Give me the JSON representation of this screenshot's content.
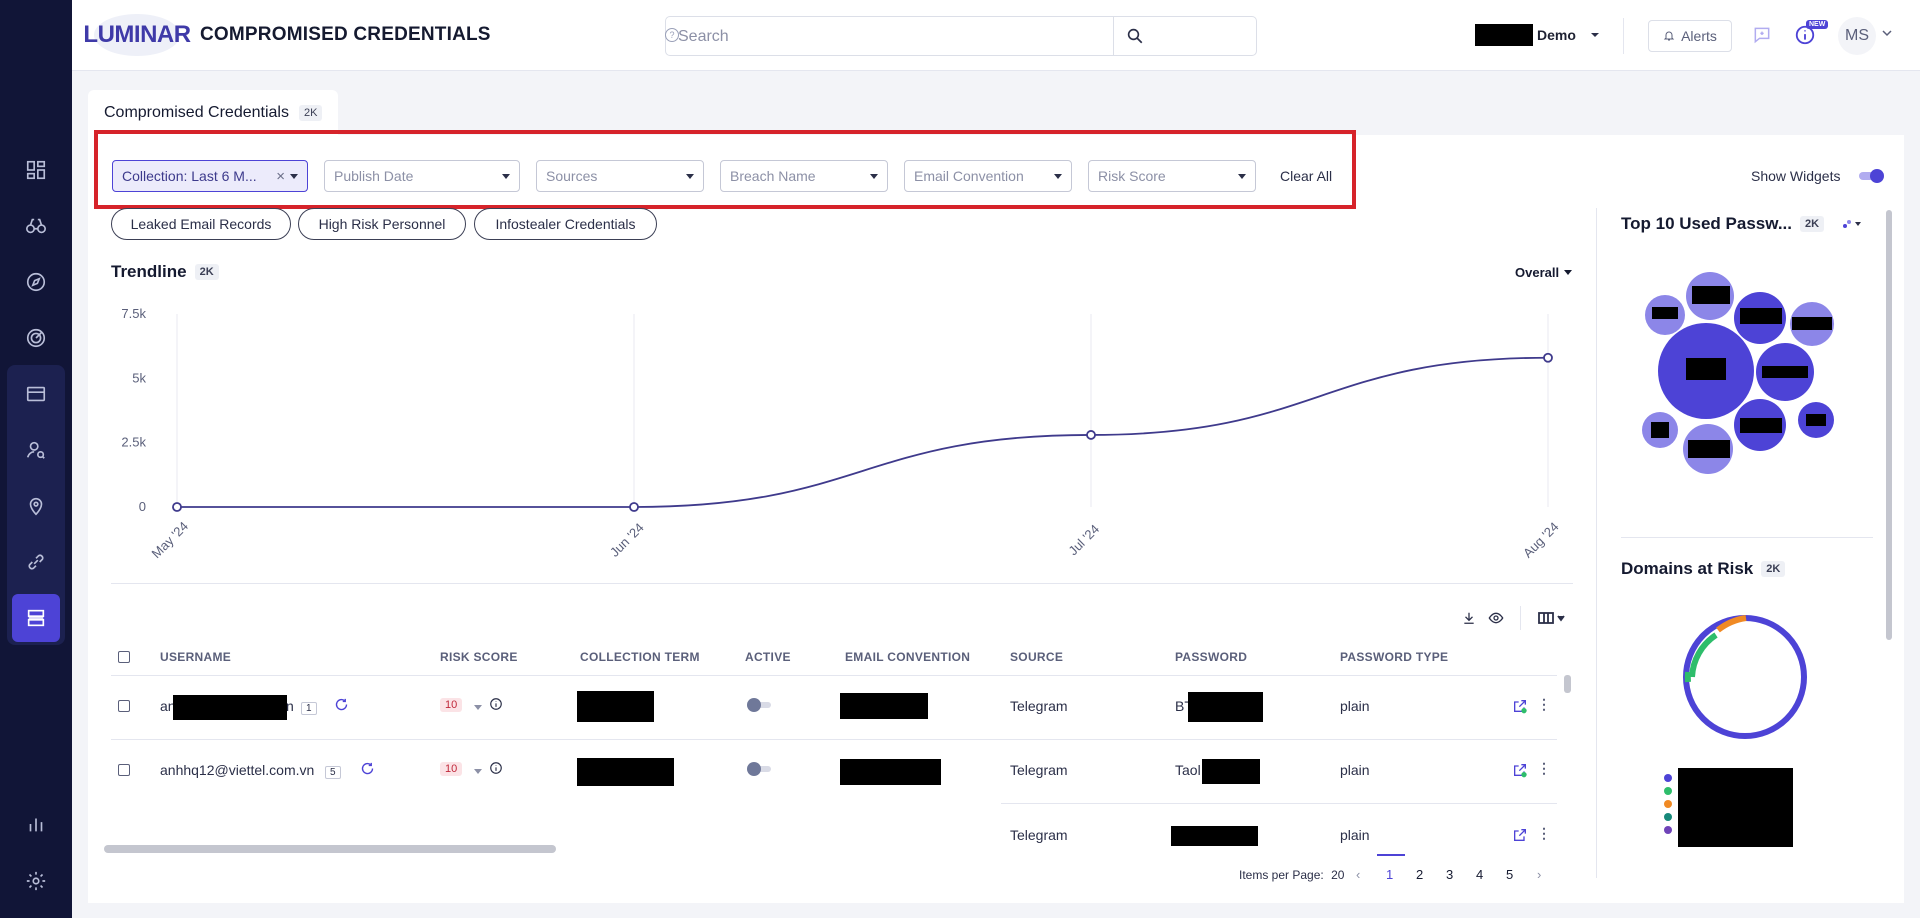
{
  "app": {
    "logo_text": "LUMINAR",
    "page_title": "COMPROMISED CREDENTIALS"
  },
  "search": {
    "placeholder": "Search"
  },
  "header": {
    "org_name": "Demo",
    "alerts_label": "Alerts",
    "new_badge": "NEW",
    "avatar_initials": "MS"
  },
  "tab": {
    "label": "Compromised Credentials",
    "count": "2K"
  },
  "filters": {
    "collection": "Collection: Last 6 M...",
    "publish_date": "Publish Date",
    "sources": "Sources",
    "breach_name": "Breach Name",
    "email_convention": "Email Convention",
    "risk_score": "Risk Score",
    "clear_all": "Clear All",
    "show_widgets": "Show Widgets"
  },
  "chips": [
    "Leaked Email Records",
    "High Risk Personnel",
    "Infostealer Credentials"
  ],
  "trendline": {
    "title": "Trendline",
    "count": "2K",
    "overall_label": "Overall"
  },
  "chart_data": {
    "type": "line",
    "x": [
      "May '24",
      "Jun '24",
      "Jul '24",
      "Aug '24"
    ],
    "series": [
      {
        "values": [
          0,
          0,
          2800,
          5800
        ]
      }
    ],
    "y_ticks": [
      "7.5k",
      "5k",
      "2.5k",
      "0"
    ],
    "ylim": [
      0,
      7500
    ],
    "grid": "vertical",
    "color": "#3f3a8c"
  },
  "table": {
    "columns": [
      "USERNAME",
      "RISK SCORE",
      "COLLECTION TERM",
      "ACTIVE",
      "EMAIL CONVENTION",
      "SOURCE",
      "PASSWORD",
      "PASSWORD TYPE"
    ],
    "rows": [
      {
        "username_prefix": "an",
        "username_suffix": "n",
        "count": "1",
        "risk": "10",
        "source": "Telegram",
        "password_prefix": "BT",
        "password_type": "plain"
      },
      {
        "username": "anhhq12@viettel.com.vn",
        "count": "5",
        "risk": "10",
        "source": "Telegram",
        "password_prefix": "Taol",
        "password_type": "plain"
      },
      {
        "source": "Telegram",
        "password_type": "plain"
      }
    ]
  },
  "pagination": {
    "items_per_page_label": "Items per Page:",
    "items_per_page": "20",
    "pages": [
      "1",
      "2",
      "3",
      "4",
      "5"
    ],
    "current": "1"
  },
  "widgets": {
    "top_passwords_title": "Top 10 Used Passw...",
    "top_passwords_count": "2K",
    "domains_title": "Domains at Risk",
    "domains_count": "2K"
  },
  "colors": {
    "accent": "#4d43d6",
    "nav_bg": "#111537",
    "highlight_frame": "#d6232a",
    "donut_primary": "#4d43d6",
    "donut_green": "#2ebd6b",
    "donut_orange": "#f08a24"
  },
  "icons": {
    "nav": [
      "dashboard-icon",
      "binoculars-icon",
      "compass-icon",
      "radar-icon",
      "card-icon",
      "user-search-icon",
      "location-icon",
      "link-icon",
      "credentials-icon",
      "analytics-icon",
      "settings-icon"
    ]
  }
}
